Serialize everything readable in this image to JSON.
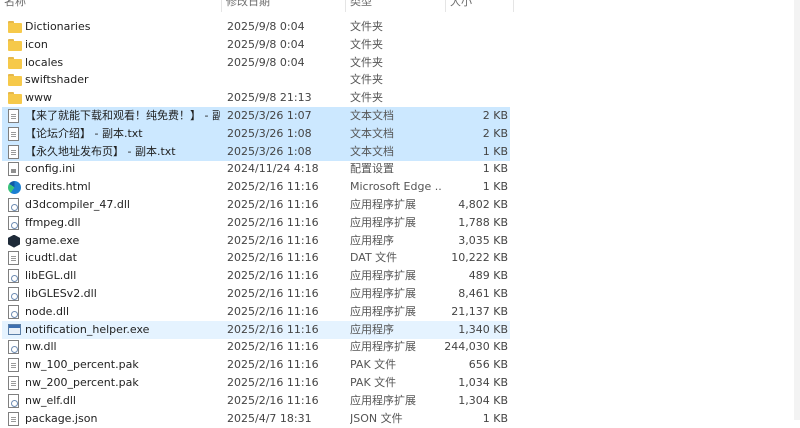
{
  "columns": {
    "name": "名称",
    "date": "修改日期",
    "type": "类型",
    "size": "大小"
  },
  "files": [
    {
      "name": "Dictionaries",
      "date": "2025/9/8 0:04",
      "type": "文件夹",
      "size": "",
      "icon": "folder-icon",
      "state": ""
    },
    {
      "name": "icon",
      "date": "2025/9/8 0:04",
      "type": "文件夹",
      "size": "",
      "icon": "folder-icon",
      "state": ""
    },
    {
      "name": "locales",
      "date": "2025/9/8 0:04",
      "type": "文件夹",
      "size": "",
      "icon": "folder-icon",
      "state": ""
    },
    {
      "name": "swiftshader",
      "date": "",
      "type": "文件夹",
      "size": "",
      "icon": "folder-icon",
      "state": ""
    },
    {
      "name": "www",
      "date": "2025/9/8 21:13",
      "type": "文件夹",
      "size": "",
      "icon": "folder-icon",
      "state": ""
    },
    {
      "name": "【来了就能下载和观看！纯免费！】 - 副…",
      "date": "2025/3/26 1:07",
      "type": "文本文档",
      "size": "2 KB",
      "icon": "text-file-icon",
      "state": "selected"
    },
    {
      "name": "【论坛介绍】 - 副本.txt",
      "date": "2025/3/26 1:08",
      "type": "文本文档",
      "size": "2 KB",
      "icon": "text-file-icon",
      "state": "selected"
    },
    {
      "name": "【永久地址发布页】 - 副本.txt",
      "date": "2025/3/26 1:08",
      "type": "文本文档",
      "size": "1 KB",
      "icon": "text-file-icon",
      "state": "selected"
    },
    {
      "name": "config.ini",
      "date": "2024/11/24 4:18",
      "type": "配置设置",
      "size": "1 KB",
      "icon": "config-file-icon",
      "state": ""
    },
    {
      "name": "credits.html",
      "date": "2025/2/16 11:16",
      "type": "Microsoft Edge ...",
      "size": "1 KB",
      "icon": "edge-icon",
      "state": ""
    },
    {
      "name": "d3dcompiler_47.dll",
      "date": "2025/2/16 11:16",
      "type": "应用程序扩展",
      "size": "4,802 KB",
      "icon": "dll-file-icon",
      "state": ""
    },
    {
      "name": "ffmpeg.dll",
      "date": "2025/2/16 11:16",
      "type": "应用程序扩展",
      "size": "1,788 KB",
      "icon": "dll-file-icon",
      "state": ""
    },
    {
      "name": "game.exe",
      "date": "2025/2/16 11:16",
      "type": "应用程序",
      "size": "3,035 KB",
      "icon": "game-exe-icon",
      "state": ""
    },
    {
      "name": "icudtl.dat",
      "date": "2025/2/16 11:16",
      "type": "DAT 文件",
      "size": "10,222 KB",
      "icon": "data-file-icon",
      "state": ""
    },
    {
      "name": "libEGL.dll",
      "date": "2025/2/16 11:16",
      "type": "应用程序扩展",
      "size": "489 KB",
      "icon": "dll-file-icon",
      "state": ""
    },
    {
      "name": "libGLESv2.dll",
      "date": "2025/2/16 11:16",
      "type": "应用程序扩展",
      "size": "8,461 KB",
      "icon": "dll-file-icon",
      "state": ""
    },
    {
      "name": "node.dll",
      "date": "2025/2/16 11:16",
      "type": "应用程序扩展",
      "size": "21,137 KB",
      "icon": "dll-file-icon",
      "state": ""
    },
    {
      "name": "notification_helper.exe",
      "date": "2025/2/16 11:16",
      "type": "应用程序",
      "size": "1,340 KB",
      "icon": "exe-icon",
      "state": "hover"
    },
    {
      "name": "nw.dll",
      "date": "2025/2/16 11:16",
      "type": "应用程序扩展",
      "size": "244,030 KB",
      "icon": "dll-file-icon",
      "state": ""
    },
    {
      "name": "nw_100_percent.pak",
      "date": "2025/2/16 11:16",
      "type": "PAK 文件",
      "size": "656 KB",
      "icon": "data-file-icon",
      "state": ""
    },
    {
      "name": "nw_200_percent.pak",
      "date": "2025/2/16 11:16",
      "type": "PAK 文件",
      "size": "1,034 KB",
      "icon": "data-file-icon",
      "state": ""
    },
    {
      "name": "nw_elf.dll",
      "date": "2025/2/16 11:16",
      "type": "应用程序扩展",
      "size": "1,304 KB",
      "icon": "dll-file-icon",
      "state": ""
    },
    {
      "name": "package.json",
      "date": "2025/4/7 18:31",
      "type": "JSON 文件",
      "size": "1 KB",
      "icon": "data-file-icon",
      "state": ""
    }
  ]
}
